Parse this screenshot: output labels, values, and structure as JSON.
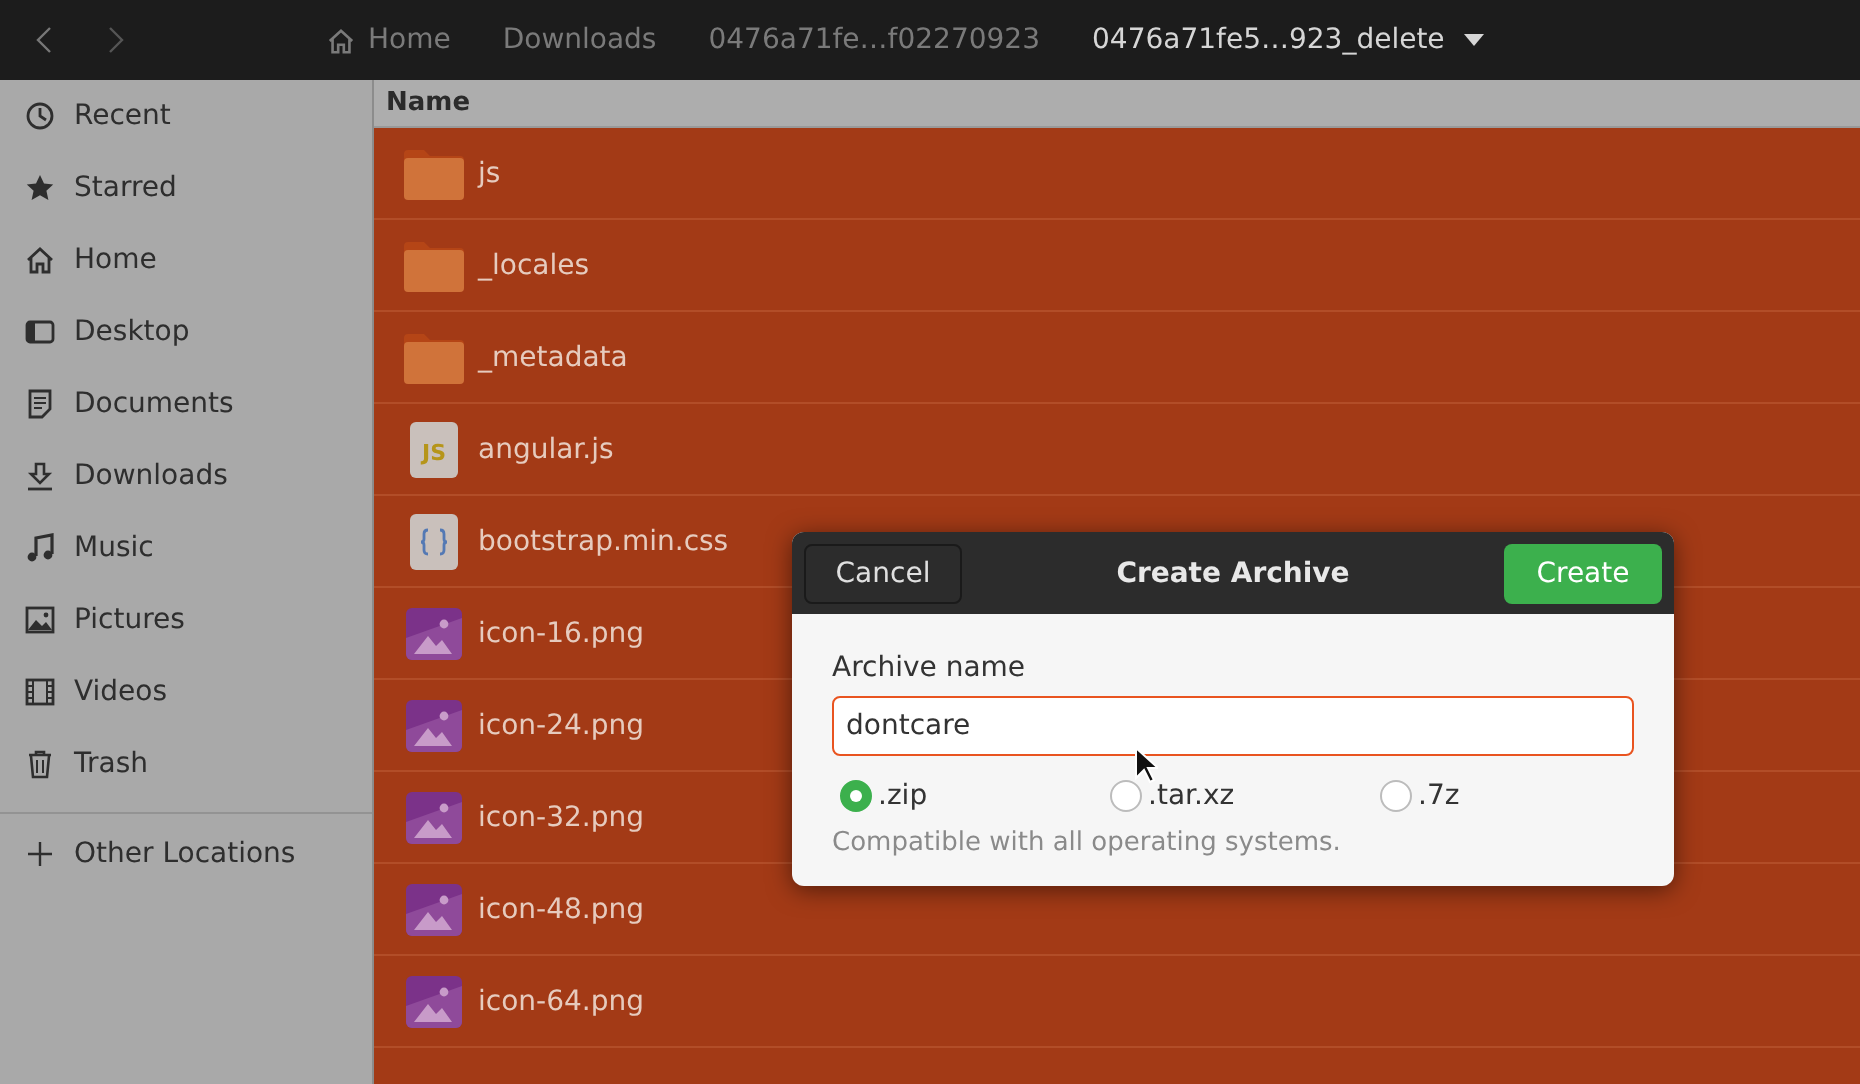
{
  "header": {
    "breadcrumbs": [
      {
        "label": "Home",
        "kind": "home",
        "selected": false
      },
      {
        "label": "Downloads",
        "kind": "plain",
        "selected": false
      },
      {
        "label": "0476a71fe…f02270923",
        "kind": "plain",
        "selected": false
      },
      {
        "label": "0476a71fe5…923_delete",
        "kind": "plain",
        "selected": true
      }
    ]
  },
  "sidebar": {
    "items": [
      {
        "label": "Recent",
        "kind": "recent"
      },
      {
        "label": "Starred",
        "kind": "star"
      },
      {
        "label": "Home",
        "kind": "home"
      },
      {
        "label": "Desktop",
        "kind": "desktop"
      },
      {
        "label": "Documents",
        "kind": "documents"
      },
      {
        "label": "Downloads",
        "kind": "downloads"
      },
      {
        "label": "Music",
        "kind": "music"
      },
      {
        "label": "Pictures",
        "kind": "pictures"
      },
      {
        "label": "Videos",
        "kind": "videos"
      },
      {
        "label": "Trash",
        "kind": "trash"
      }
    ],
    "other": {
      "label": "Other Locations"
    }
  },
  "file_list": {
    "column": "Name",
    "rows": [
      {
        "name": "js",
        "kind": "folder",
        "selected": true
      },
      {
        "name": "_locales",
        "kind": "folder",
        "selected": true
      },
      {
        "name": "_metadata",
        "kind": "folder",
        "selected": true
      },
      {
        "name": "angular.js",
        "kind": "js",
        "badge": "JS",
        "selected": true
      },
      {
        "name": "bootstrap.min.css",
        "kind": "css",
        "selected": true
      },
      {
        "name": "icon-16.png",
        "kind": "image",
        "selected": true
      },
      {
        "name": "icon-24.png",
        "kind": "image",
        "selected": true
      },
      {
        "name": "icon-32.png",
        "kind": "image",
        "selected": true
      },
      {
        "name": "icon-48.png",
        "kind": "image",
        "selected": true
      },
      {
        "name": "icon-64.png",
        "kind": "image",
        "selected": true
      }
    ]
  },
  "dialog": {
    "title": "Create Archive",
    "cancel": "Cancel",
    "confirm": "Create",
    "field_label": "Archive name",
    "value": "dontcare",
    "formats": [
      {
        "label": ".zip",
        "selected": true
      },
      {
        "label": ".tar.xz",
        "selected": false
      },
      {
        "label": ".7z",
        "selected": false
      }
    ],
    "hint": "Compatible with all operating systems."
  }
}
